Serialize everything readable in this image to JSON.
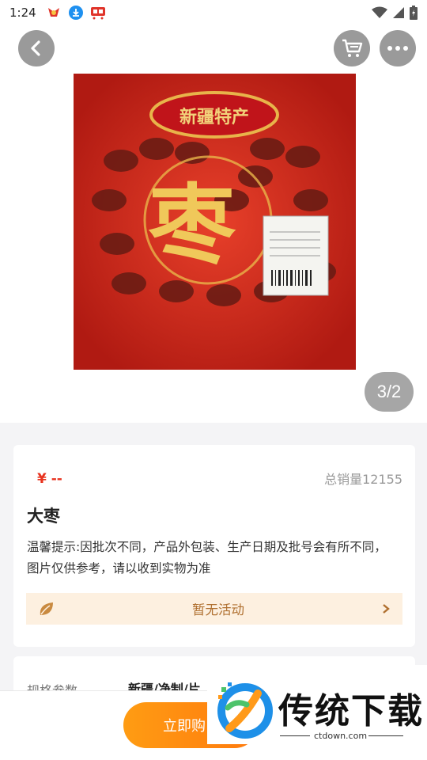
{
  "status_bar": {
    "time": "1:24"
  },
  "hero": {
    "page_indicator": "3/2"
  },
  "product": {
    "price": "¥ --",
    "sales": "总销量12155",
    "name": "大枣",
    "tip": "温馨提示:因批次不同，产品外包装、生产日期及批号会有所不同，图片仅供参考，请以收到实物为准",
    "package_label": "新疆特产",
    "package_brand": "枣",
    "promotion": "暂无活动"
  },
  "specs": {
    "label": "规格参数",
    "value": "新疆/净制/片"
  },
  "bottom": {
    "buy_label": "立即购"
  },
  "watermark": {
    "brand": "传统下载",
    "url": "ctdown.com"
  },
  "colors": {
    "accent": "#ff8a10",
    "price": "#e8321e",
    "promo_bg": "#fdf0e0",
    "promo_text": "#b07030"
  },
  "icons": [
    "back-icon",
    "cart-icon",
    "more-icon",
    "leaf-icon",
    "chevron-right-icon",
    "wifi-icon",
    "signal-icon",
    "battery-icon"
  ]
}
